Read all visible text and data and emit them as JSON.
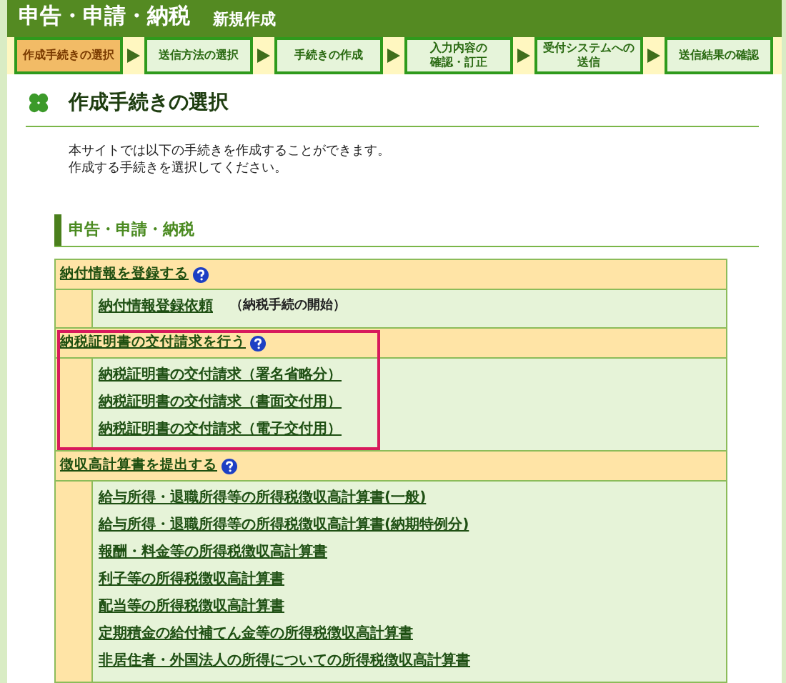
{
  "header": {
    "title": "申告・申請・納税",
    "subtitle": "新規作成"
  },
  "steps": [
    {
      "label": "作成手続きの選択",
      "selected": true
    },
    {
      "label": "送信方法の選択",
      "selected": false
    },
    {
      "label": "手続きの作成",
      "selected": false
    },
    {
      "lines": [
        "入力内容の",
        "確認・訂正"
      ],
      "selected": false
    },
    {
      "lines": [
        "受付システムへの",
        "送信"
      ],
      "selected": false
    },
    {
      "label": "送信結果の確認",
      "selected": false
    }
  ],
  "page_title": "作成手続きの選択",
  "intro": [
    "本サイトでは以下の手続きを作成することができます。",
    "作成する手続きを選択してください。"
  ],
  "section_title": "申告・申請・納税",
  "groups": [
    {
      "title": "納付情報を登録する",
      "highlighted": false,
      "items": [
        {
          "label": "納付情報登録依頼",
          "note": "（納税手続の開始）"
        }
      ]
    },
    {
      "title": "納税証明書の交付請求を行う",
      "highlighted": true,
      "items": [
        {
          "label": "納税証明書の交付請求（署名省略分）"
        },
        {
          "label": "納税証明書の交付請求（書面交付用）"
        },
        {
          "label": "納税証明書の交付請求（電子交付用）"
        }
      ]
    },
    {
      "title": "徴収高計算書を提出する",
      "highlighted": false,
      "items": [
        {
          "label": "給与所得・退職所得等の所得税徴収高計算書(一般)"
        },
        {
          "label": "給与所得・退職所得等の所得税徴収高計算書(納期特例分)"
        },
        {
          "label": "報酬・料金等の所得税徴収高計算書"
        },
        {
          "label": "利子等の所得税徴収高計算書"
        },
        {
          "label": "配当等の所得税徴収高計算書"
        },
        {
          "label": "定期積金の給付補てん金等の所得税徴収高計算書"
        },
        {
          "label": "非居住者・外国法人の所得についての所得税徴収高計算書"
        }
      ]
    }
  ]
}
